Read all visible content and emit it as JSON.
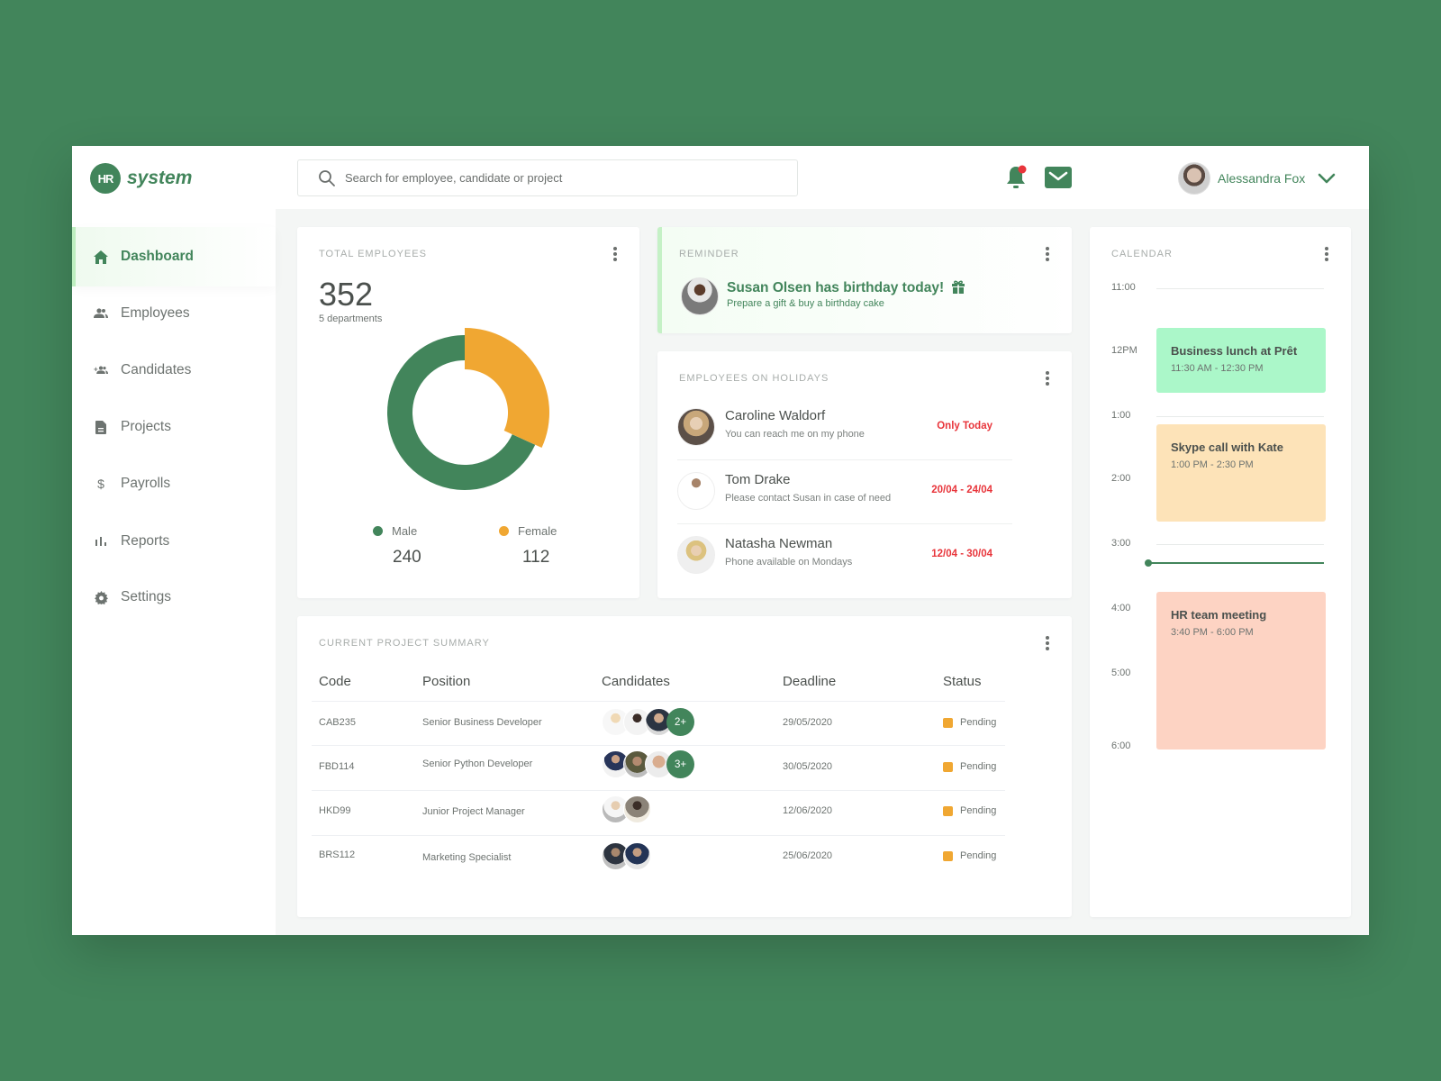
{
  "brand": {
    "badge": "HR",
    "name": "system",
    "accent": "#42855b"
  },
  "search": {
    "placeholder": "Search for employee, candidate or project"
  },
  "header": {
    "notifications_icon": "bell-icon",
    "has_unread": true,
    "mail_icon": "mail-icon",
    "user_name": "Alessandra Fox"
  },
  "sidebar": {
    "items": [
      {
        "label": "Dashboard",
        "icon": "home-icon",
        "active": true
      },
      {
        "label": "Employees",
        "icon": "people-icon"
      },
      {
        "label": "Candidates",
        "icon": "add-people-icon"
      },
      {
        "label": "Projects",
        "icon": "document-icon"
      },
      {
        "label": "Payrolls",
        "icon": "dollar-icon"
      },
      {
        "label": "Reports",
        "icon": "bar-chart-icon"
      },
      {
        "label": "Settings",
        "icon": "gear-icon"
      }
    ]
  },
  "total_employees": {
    "title": "TOTAL EMPLOYEES",
    "total": "352",
    "subtitle": "5 departments",
    "legend": [
      {
        "label": "Male",
        "value": "240",
        "color": "#42855b"
      },
      {
        "label": "Female",
        "value": "112",
        "color": "#f0a732"
      }
    ]
  },
  "chart_data": {
    "type": "pie",
    "title": "TOTAL EMPLOYEES",
    "categories": [
      "Male",
      "Female"
    ],
    "values": [
      240,
      112
    ],
    "colors": [
      "#42855b",
      "#f0a732"
    ],
    "donut": true
  },
  "reminder": {
    "title": "REMINDER",
    "headline": "Susan Olsen has birthday today!",
    "subtext": "Prepare a gift & buy a birthday cake"
  },
  "holidays": {
    "title": "EMPLOYEES ON HOLIDAYS",
    "rows": [
      {
        "name": "Caroline Waldorf",
        "message": "You can reach me on my phone",
        "date": "Only Today"
      },
      {
        "name": "Tom Drake",
        "message": "Please contact Susan in case of need",
        "date": "20/04 - 24/04"
      },
      {
        "name": "Natasha Newman",
        "message": "Phone available on Mondays",
        "date": "12/04 - 30/04"
      }
    ]
  },
  "projects": {
    "title": "CURRENT PROJECT SUMMARY",
    "columns": [
      "Code",
      "Position",
      "Candidates",
      "Deadline",
      "Status"
    ],
    "rows": [
      {
        "code": "CAB235",
        "position": "Senior Business Developer",
        "candidates_shown": 3,
        "more": "2+",
        "deadline": "29/05/2020",
        "status": "Pending"
      },
      {
        "code": "FBD114",
        "position": "Senior Python Developer",
        "candidates_shown": 3,
        "more": "3+",
        "deadline": "30/05/2020",
        "status": "Pending"
      },
      {
        "code": "HKD99",
        "position": "Junior Project Manager",
        "candidates_shown": 2,
        "more": "",
        "deadline": "12/06/2020",
        "status": "Pending"
      },
      {
        "code": "BRS112",
        "position": "Marketing Specialist",
        "candidates_shown": 2,
        "more": "",
        "deadline": "25/06/2020",
        "status": "Pending"
      }
    ],
    "status_color": "#f0a732"
  },
  "calendar": {
    "title": "CALENDAR",
    "hours": [
      "11:00",
      "12PM",
      "1:00",
      "2:00",
      "3:00",
      "4:00",
      "5:00",
      "6:00"
    ],
    "events": [
      {
        "title": "Business lunch at Prêt",
        "time": "11:30 AM - 12:30 PM",
        "color": "#abf7c9"
      },
      {
        "title": "Skype call with Kate",
        "time": "1:00 PM - 2:30 PM",
        "color": "#fde3b8"
      },
      {
        "title": "HR team meeting",
        "time": "3:40 PM - 6:00 PM",
        "color": "#fdd3c3"
      }
    ]
  }
}
